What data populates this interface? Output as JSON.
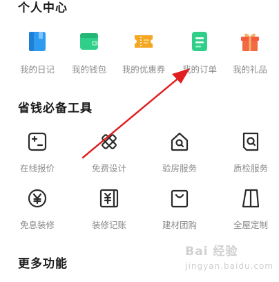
{
  "sections": {
    "personal": "个人中心",
    "tools": "省钱必备工具",
    "more": "更多功能"
  },
  "personal_items": [
    {
      "label": "我的日记",
      "icon": "diary-icon",
      "color": "#2f9bf0"
    },
    {
      "label": "我的钱包",
      "icon": "wallet-icon",
      "color": "#2fcf8a"
    },
    {
      "label": "我的优惠券",
      "icon": "coupon-icon",
      "color": "#f5a623"
    },
    {
      "label": "我的订单",
      "icon": "order-icon",
      "color": "#2fcf8a"
    },
    {
      "label": "我的礼品",
      "icon": "gift-icon",
      "color": "#f55b3b"
    }
  ],
  "tools_row1": [
    {
      "label": "在线报价",
      "icon": "calculator-icon"
    },
    {
      "label": "免费设计",
      "icon": "design-tools-icon"
    },
    {
      "label": "验房服务",
      "icon": "house-search-icon"
    },
    {
      "label": "质检服务",
      "icon": "inspection-icon"
    }
  ],
  "tools_row2": [
    {
      "label": "免息装修",
      "icon": "yuan-coin-icon"
    },
    {
      "label": "装修记账",
      "icon": "ledger-icon"
    },
    {
      "label": "建材团购",
      "icon": "shopping-bag-icon"
    },
    {
      "label": "全屋定制",
      "icon": "wardrobe-icon"
    }
  ],
  "watermark": {
    "main": "Bai 经验",
    "sub": "jingyan.baidu.com"
  },
  "colors": {
    "arrow": "#e02020",
    "icon_stroke": "#2a2a2a",
    "label": "#8a8a8a"
  }
}
